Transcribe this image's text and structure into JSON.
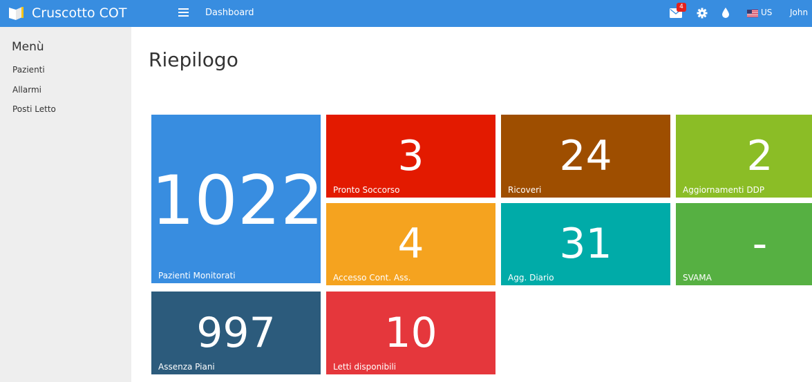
{
  "header": {
    "brand": "Cruscotto COT",
    "nav_dashboard": "Dashboard",
    "mail_count": "4",
    "language": "US",
    "user": "John",
    "colors": {
      "bar": "#388de0",
      "badge": "#e3221d"
    }
  },
  "sidebar": {
    "title": "Menù",
    "items": [
      {
        "label": "Pazienti"
      },
      {
        "label": "Allarmi"
      },
      {
        "label": "Posti Letto"
      }
    ]
  },
  "main": {
    "title": "Riepilogo",
    "tiles": [
      {
        "value": "1022",
        "label": "Pazienti Monitorati",
        "color": "#388de0"
      },
      {
        "value": "3",
        "label": "Pronto Soccorso",
        "color": "#e31a00"
      },
      {
        "value": "24",
        "label": "Ricoveri",
        "color": "#9e4e00"
      },
      {
        "value": "2",
        "label": "Aggiornamenti DDP",
        "color": "#8bbd26"
      },
      {
        "value": "4",
        "label": "Accesso Cont. Ass.",
        "color": "#f5a31f"
      },
      {
        "value": "31",
        "label": "Agg. Diario",
        "color": "#00aba8"
      },
      {
        "value": "-",
        "label": "SVAMA",
        "color": "#56b042"
      },
      {
        "value": "997",
        "label": "Assenza Piani",
        "color": "#2c5b7c"
      },
      {
        "value": "10",
        "label": "Letti disponibili",
        "color": "#e5373c"
      }
    ]
  }
}
